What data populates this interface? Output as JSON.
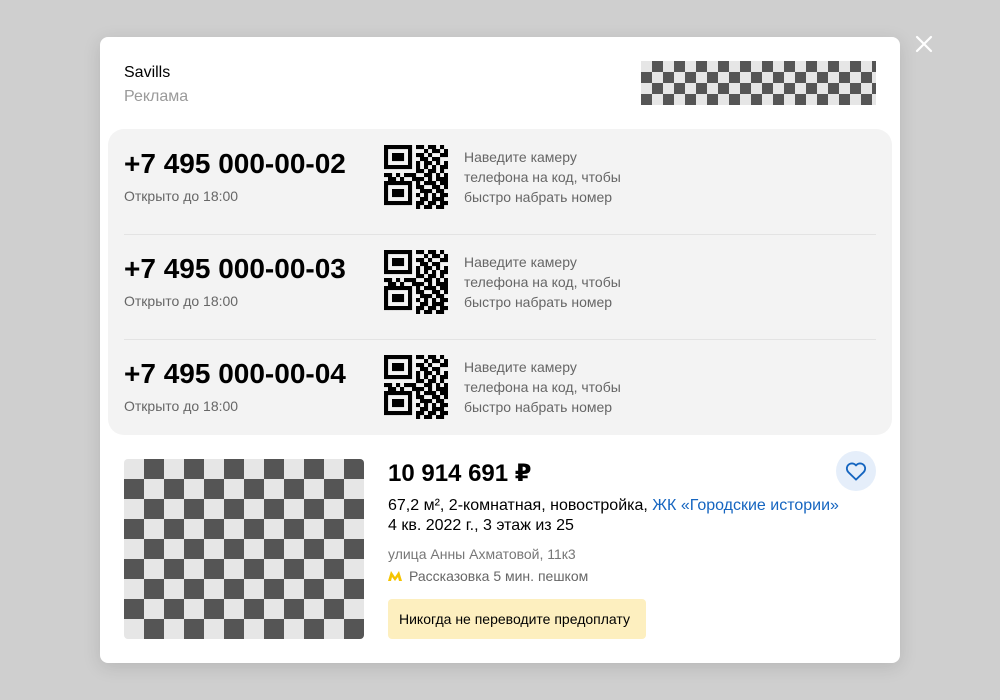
{
  "header": {
    "company": "Savills",
    "ad_label": "Реклама"
  },
  "phones": [
    {
      "number": "+7 495 000-00-02",
      "hours": "Открыто до 18:00",
      "qr_hint": "Наведите камеру телефона на код, чтобы быстро набрать номер"
    },
    {
      "number": "+7 495 000-00-03",
      "hours": "Открыто до 18:00",
      "qr_hint": "Наведите камеру телефона на код, чтобы быстро набрать номер"
    },
    {
      "number": "+7 495 000-00-04",
      "hours": "Открыто до 18:00",
      "qr_hint": "Наведите камеру телефона на код, чтобы быстро набрать номер"
    }
  ],
  "listing": {
    "price": "10 914 691 ₽",
    "description": "67,2 м², 2-комнатная, новостройка,",
    "complex_link": "ЖК «Городские истории»",
    "completion": "4 кв. 2022 г., 3 этаж из 25",
    "address": "улица Анны Ахматовой, 11к3",
    "metro": "Рассказовка 5 мин. пешком",
    "warning": "Никогда не переводите предоплату"
  },
  "icons": {
    "close": "close-icon",
    "favorite": "heart-icon",
    "metro": "metro-icon",
    "qr": "qr-code-icon"
  },
  "colors": {
    "link": "#1565c0",
    "favorite_bg": "#e5eefa",
    "favorite_icon": "#1565c0",
    "metro": "#f5c400",
    "warning_bg": "#fdefbf"
  }
}
